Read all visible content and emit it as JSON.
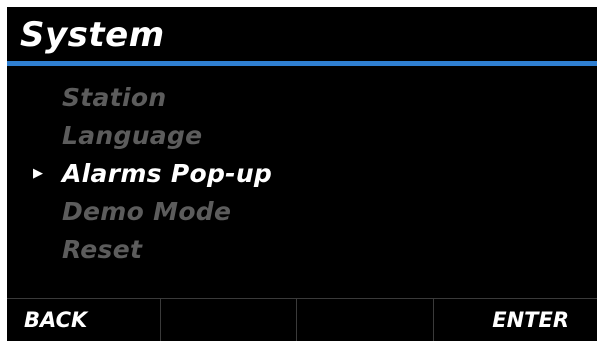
{
  "header": {
    "title": "System"
  },
  "menu": {
    "items": [
      {
        "label": "Station",
        "selected": false
      },
      {
        "label": "Language",
        "selected": false
      },
      {
        "label": "Alarms Pop-up",
        "selected": true
      },
      {
        "label": "Demo Mode",
        "selected": false
      },
      {
        "label": "Reset",
        "selected": false
      }
    ],
    "selection_marker_icon": "triangle-right-icon"
  },
  "softkeys": {
    "key1": "BACK",
    "key2": "",
    "key3": "",
    "key4": "ENTER"
  },
  "colors": {
    "background": "#000000",
    "accent": "#2f7fd1",
    "text_active": "#ffffff",
    "text_inactive": "#5c5c5c",
    "divider": "#3a3a3a"
  }
}
